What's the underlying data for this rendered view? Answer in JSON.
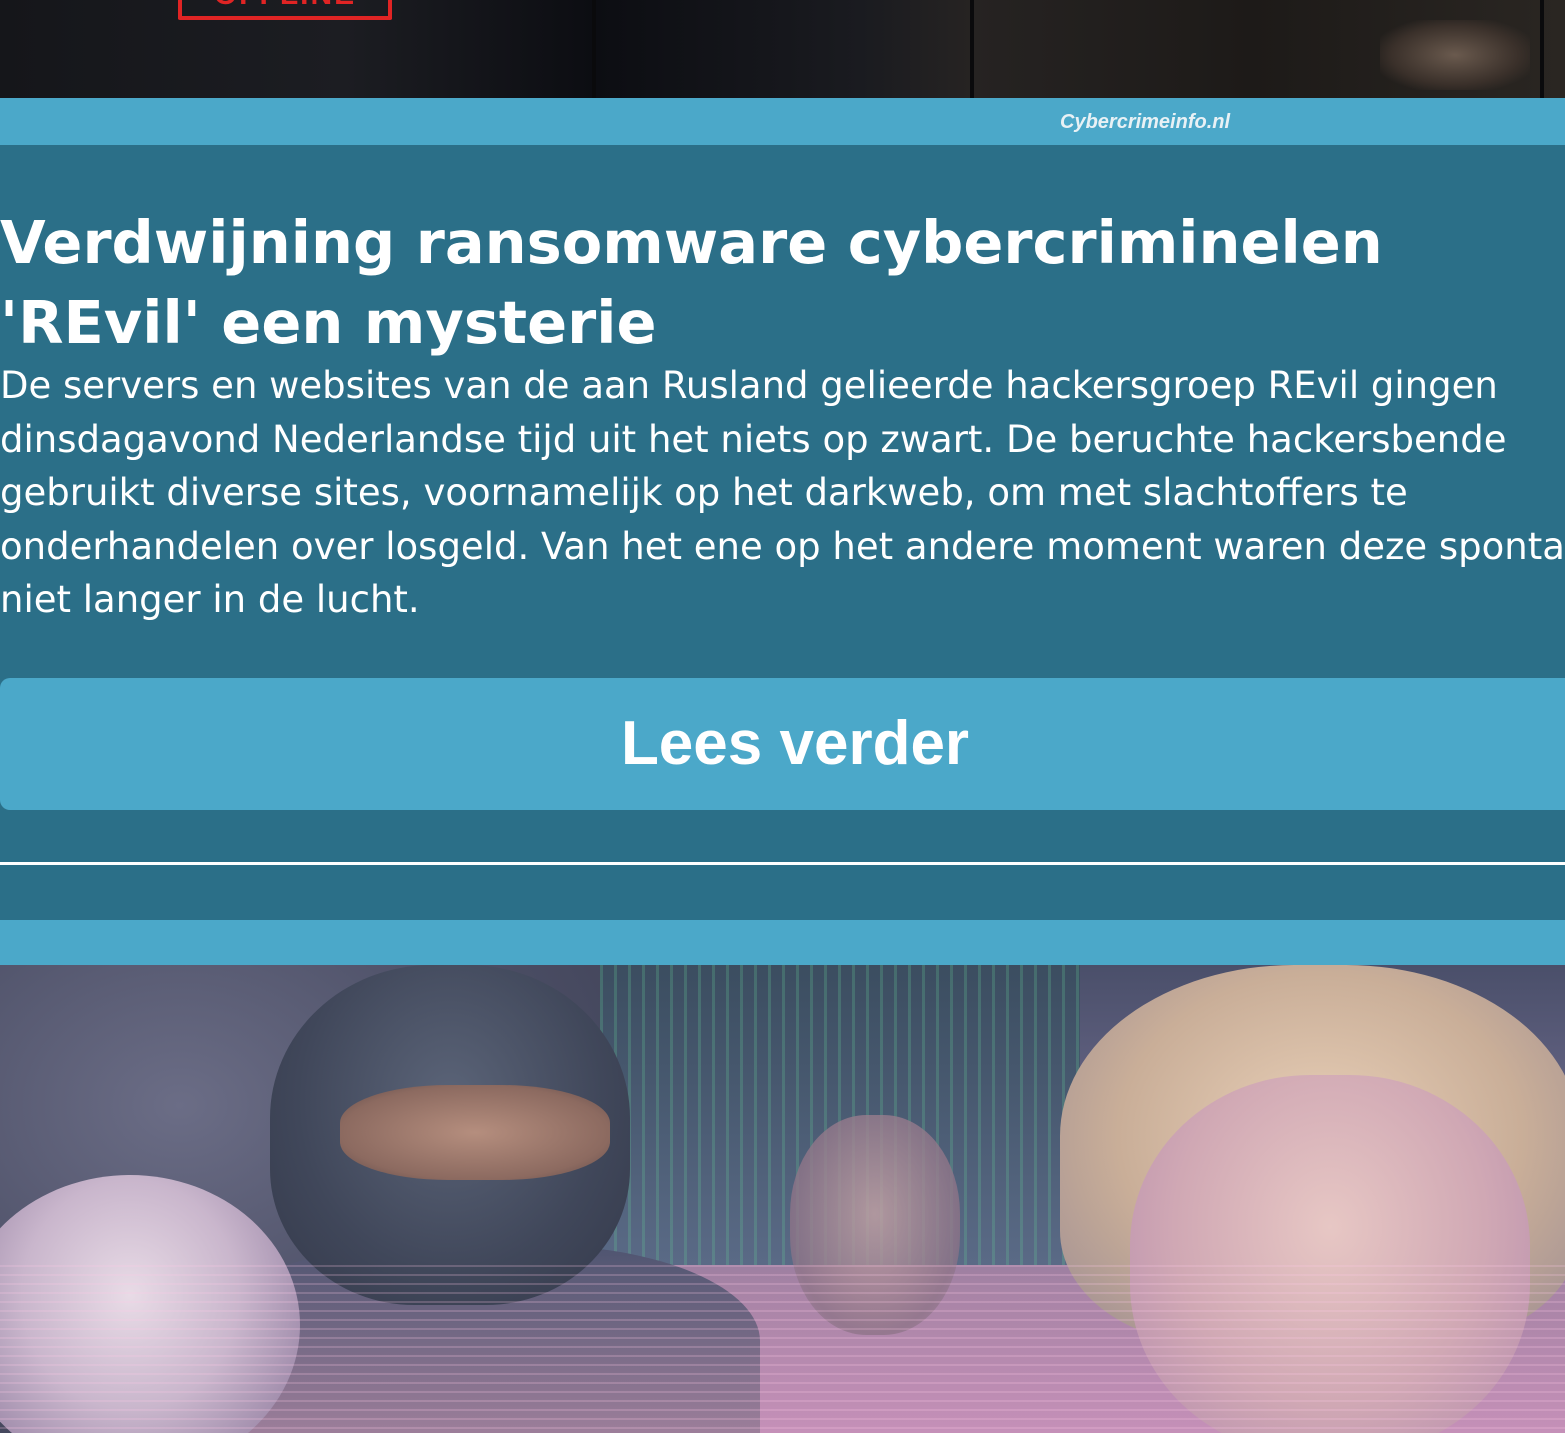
{
  "top_image": {
    "stamp_text": "OFFLINE",
    "alt": "top-article-image"
  },
  "caption": {
    "source": "Cybercrimeinfo.nl"
  },
  "article": {
    "title": "Verdwijning ransomware cybercriminelen 'REvil' een mysterie",
    "body_lines": [
      "De servers en websites van de aan Rusland gelieerde hackersgroep REvil gingen",
      "dinsdagavond Nederlandse tijd uit het niets op zwart. De beruchte hackersbende",
      "gebruikt diverse sites, voornamelijk op het darkweb, om met slachtoffers te",
      "onderhandelen over losgeld. Van het ene op het andere moment waren deze spontaan",
      "niet langer in de lucht."
    ],
    "read_more_label": "Lees verder"
  },
  "colors": {
    "accent": "#4ba8c9",
    "article_bg": "#2b6f88",
    "text": "#ffffff",
    "stamp": "#e02424"
  }
}
